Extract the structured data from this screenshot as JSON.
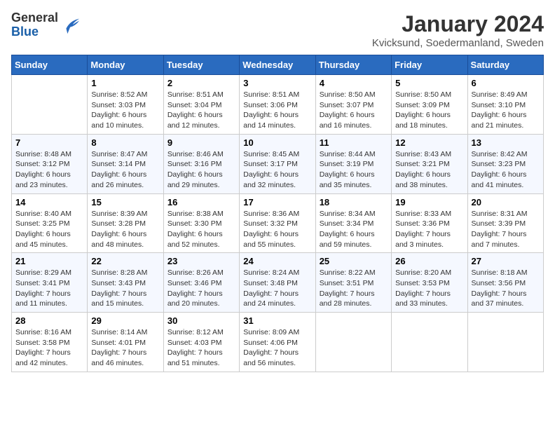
{
  "header": {
    "logo_general": "General",
    "logo_blue": "Blue",
    "month_title": "January 2024",
    "location": "Kvicksund, Soedermanland, Sweden"
  },
  "weekdays": [
    "Sunday",
    "Monday",
    "Tuesday",
    "Wednesday",
    "Thursday",
    "Friday",
    "Saturday"
  ],
  "weeks": [
    [
      {
        "day": "",
        "info": ""
      },
      {
        "day": "1",
        "info": "Sunrise: 8:52 AM\nSunset: 3:03 PM\nDaylight: 6 hours\nand 10 minutes."
      },
      {
        "day": "2",
        "info": "Sunrise: 8:51 AM\nSunset: 3:04 PM\nDaylight: 6 hours\nand 12 minutes."
      },
      {
        "day": "3",
        "info": "Sunrise: 8:51 AM\nSunset: 3:06 PM\nDaylight: 6 hours\nand 14 minutes."
      },
      {
        "day": "4",
        "info": "Sunrise: 8:50 AM\nSunset: 3:07 PM\nDaylight: 6 hours\nand 16 minutes."
      },
      {
        "day": "5",
        "info": "Sunrise: 8:50 AM\nSunset: 3:09 PM\nDaylight: 6 hours\nand 18 minutes."
      },
      {
        "day": "6",
        "info": "Sunrise: 8:49 AM\nSunset: 3:10 PM\nDaylight: 6 hours\nand 21 minutes."
      }
    ],
    [
      {
        "day": "7",
        "info": "Sunrise: 8:48 AM\nSunset: 3:12 PM\nDaylight: 6 hours\nand 23 minutes."
      },
      {
        "day": "8",
        "info": "Sunrise: 8:47 AM\nSunset: 3:14 PM\nDaylight: 6 hours\nand 26 minutes."
      },
      {
        "day": "9",
        "info": "Sunrise: 8:46 AM\nSunset: 3:16 PM\nDaylight: 6 hours\nand 29 minutes."
      },
      {
        "day": "10",
        "info": "Sunrise: 8:45 AM\nSunset: 3:17 PM\nDaylight: 6 hours\nand 32 minutes."
      },
      {
        "day": "11",
        "info": "Sunrise: 8:44 AM\nSunset: 3:19 PM\nDaylight: 6 hours\nand 35 minutes."
      },
      {
        "day": "12",
        "info": "Sunrise: 8:43 AM\nSunset: 3:21 PM\nDaylight: 6 hours\nand 38 minutes."
      },
      {
        "day": "13",
        "info": "Sunrise: 8:42 AM\nSunset: 3:23 PM\nDaylight: 6 hours\nand 41 minutes."
      }
    ],
    [
      {
        "day": "14",
        "info": "Sunrise: 8:40 AM\nSunset: 3:25 PM\nDaylight: 6 hours\nand 45 minutes."
      },
      {
        "day": "15",
        "info": "Sunrise: 8:39 AM\nSunset: 3:28 PM\nDaylight: 6 hours\nand 48 minutes."
      },
      {
        "day": "16",
        "info": "Sunrise: 8:38 AM\nSunset: 3:30 PM\nDaylight: 6 hours\nand 52 minutes."
      },
      {
        "day": "17",
        "info": "Sunrise: 8:36 AM\nSunset: 3:32 PM\nDaylight: 6 hours\nand 55 minutes."
      },
      {
        "day": "18",
        "info": "Sunrise: 8:34 AM\nSunset: 3:34 PM\nDaylight: 6 hours\nand 59 minutes."
      },
      {
        "day": "19",
        "info": "Sunrise: 8:33 AM\nSunset: 3:36 PM\nDaylight: 7 hours\nand 3 minutes."
      },
      {
        "day": "20",
        "info": "Sunrise: 8:31 AM\nSunset: 3:39 PM\nDaylight: 7 hours\nand 7 minutes."
      }
    ],
    [
      {
        "day": "21",
        "info": "Sunrise: 8:29 AM\nSunset: 3:41 PM\nDaylight: 7 hours\nand 11 minutes."
      },
      {
        "day": "22",
        "info": "Sunrise: 8:28 AM\nSunset: 3:43 PM\nDaylight: 7 hours\nand 15 minutes."
      },
      {
        "day": "23",
        "info": "Sunrise: 8:26 AM\nSunset: 3:46 PM\nDaylight: 7 hours\nand 20 minutes."
      },
      {
        "day": "24",
        "info": "Sunrise: 8:24 AM\nSunset: 3:48 PM\nDaylight: 7 hours\nand 24 minutes."
      },
      {
        "day": "25",
        "info": "Sunrise: 8:22 AM\nSunset: 3:51 PM\nDaylight: 7 hours\nand 28 minutes."
      },
      {
        "day": "26",
        "info": "Sunrise: 8:20 AM\nSunset: 3:53 PM\nDaylight: 7 hours\nand 33 minutes."
      },
      {
        "day": "27",
        "info": "Sunrise: 8:18 AM\nSunset: 3:56 PM\nDaylight: 7 hours\nand 37 minutes."
      }
    ],
    [
      {
        "day": "28",
        "info": "Sunrise: 8:16 AM\nSunset: 3:58 PM\nDaylight: 7 hours\nand 42 minutes."
      },
      {
        "day": "29",
        "info": "Sunrise: 8:14 AM\nSunset: 4:01 PM\nDaylight: 7 hours\nand 46 minutes."
      },
      {
        "day": "30",
        "info": "Sunrise: 8:12 AM\nSunset: 4:03 PM\nDaylight: 7 hours\nand 51 minutes."
      },
      {
        "day": "31",
        "info": "Sunrise: 8:09 AM\nSunset: 4:06 PM\nDaylight: 7 hours\nand 56 minutes."
      },
      {
        "day": "",
        "info": ""
      },
      {
        "day": "",
        "info": ""
      },
      {
        "day": "",
        "info": ""
      }
    ]
  ]
}
